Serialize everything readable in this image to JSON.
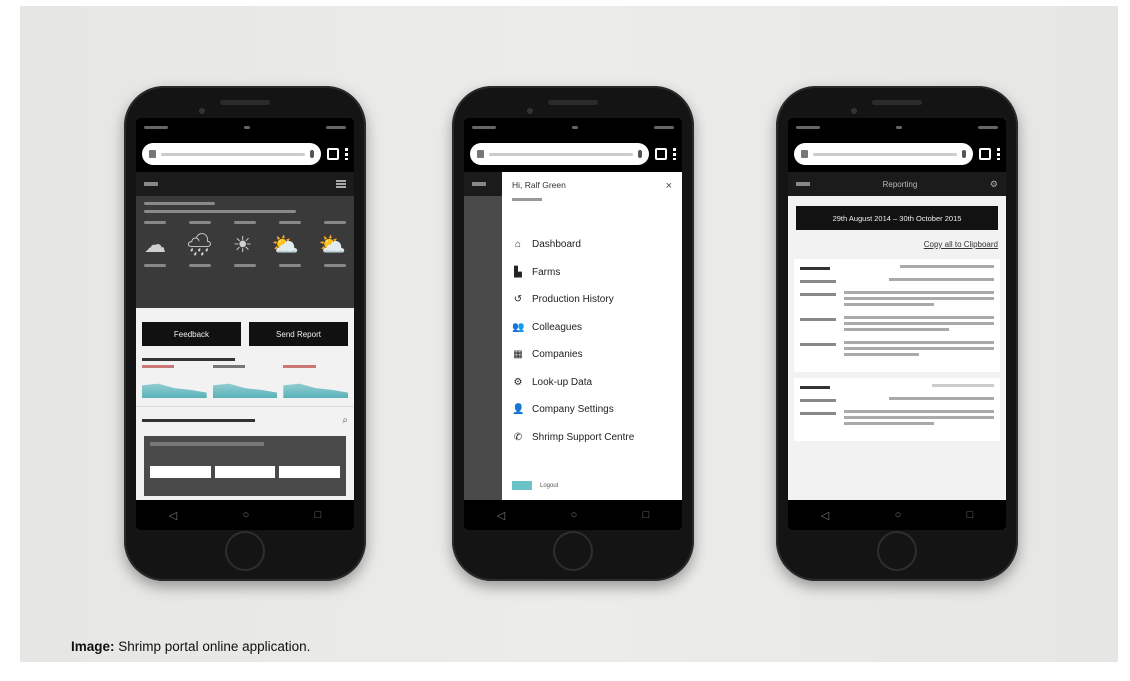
{
  "caption": {
    "label": "Image:",
    "text": "Shrimp portal online application."
  },
  "phone1": {
    "buttons": {
      "feedback": "Feedback",
      "report": "Send Report"
    },
    "weather_icons": [
      "☁",
      "🌧",
      "☀",
      "⛅",
      "⛅"
    ]
  },
  "phone2": {
    "greeting": "Hi, Ralf Green",
    "close": "×",
    "menu": [
      {
        "icon": "⌂",
        "label": "Dashboard"
      },
      {
        "icon": "▙",
        "label": "Farms"
      },
      {
        "icon": "↺",
        "label": "Production History"
      },
      {
        "icon": "👥",
        "label": "Colleagues"
      },
      {
        "icon": "▦",
        "label": "Companies"
      },
      {
        "icon": "⚙",
        "label": "Look-up Data"
      },
      {
        "icon": "👤",
        "label": "Company Settings"
      },
      {
        "icon": "✆",
        "label": "Shrimp Support Centre"
      }
    ],
    "logout": "Logout"
  },
  "phone3": {
    "appbar_title": "Reporting",
    "date_range": "29th August 2014 – 30th October 2015",
    "copy_link": "Copy all to Clipboard"
  },
  "colors": {
    "teal": "#59b1b9",
    "dark": "#111111"
  }
}
